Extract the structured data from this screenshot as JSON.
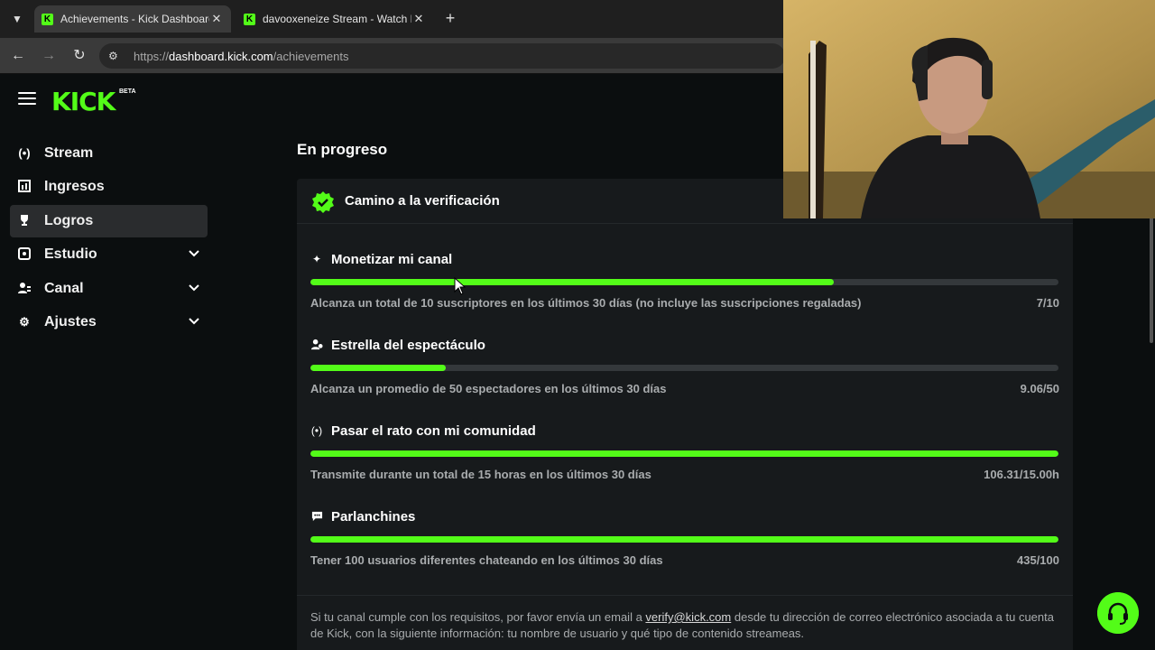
{
  "browser": {
    "tabs": [
      {
        "title": "Achievements - Kick Dashboard",
        "active": true
      },
      {
        "title": "davooxeneize Stream - Watch L",
        "active": false
      }
    ],
    "url": {
      "scheme": "https://",
      "host": "dashboard.kick.com",
      "path": "/achievements"
    }
  },
  "logo": {
    "text": "KICK",
    "badge": "BETA"
  },
  "sidebar": {
    "items": [
      {
        "label": "Stream",
        "icon": "broadcast-icon",
        "active": false,
        "expandable": false
      },
      {
        "label": "Ingresos",
        "icon": "chart-icon",
        "active": false,
        "expandable": false
      },
      {
        "label": "Logros",
        "icon": "trophy-icon",
        "active": true,
        "expandable": false
      },
      {
        "label": "Estudio",
        "icon": "studio-icon",
        "active": false,
        "expandable": true
      },
      {
        "label": "Canal",
        "icon": "users-icon",
        "active": false,
        "expandable": true
      },
      {
        "label": "Ajustes",
        "icon": "gear-icon",
        "active": false,
        "expandable": true
      }
    ]
  },
  "main": {
    "section_title": "En progreso",
    "card": {
      "title": "Camino a la verificación",
      "achievements": [
        {
          "title": "Monetizar mi canal",
          "icon": "sparkle-icon",
          "description": "Alcanza un total de 10 suscriptores en los últimos 30 días (no incluye las suscripciones regaladas)",
          "value": "7/10",
          "progress": 0.7
        },
        {
          "title": "Estrella del espectáculo",
          "icon": "viewers-icon",
          "description": "Alcanza un promedio de 50 espectadores en los últimos 30 días",
          "value": "9.06/50",
          "progress": 0.181
        },
        {
          "title": "Pasar el rato con mi comunidad",
          "icon": "broadcast-icon",
          "description": "Transmite durante un total de 15 horas en los últimos 30 días",
          "value": "106.31/15.00h",
          "progress": 1.0
        },
        {
          "title": "Parlanchines",
          "icon": "chat-icon",
          "description": "Tener 100 usuarios diferentes chateando en los últimos 30 días",
          "value": "435/100",
          "progress": 1.0
        }
      ],
      "footer": {
        "before": "Si tu canal cumple con los requisitos, por favor envía un email a ",
        "email": "verify@kick.com",
        "after": " desde tu dirección de correo electrónico asociada a tu cuenta de Kick, con la siguiente información: tu nombre de usuario y qué tipo de contenido streameas."
      }
    }
  },
  "colors": {
    "accent": "#53fc18",
    "background": "#0b0e0f",
    "card": "#171a1c",
    "muted_text": "#a9acae"
  }
}
